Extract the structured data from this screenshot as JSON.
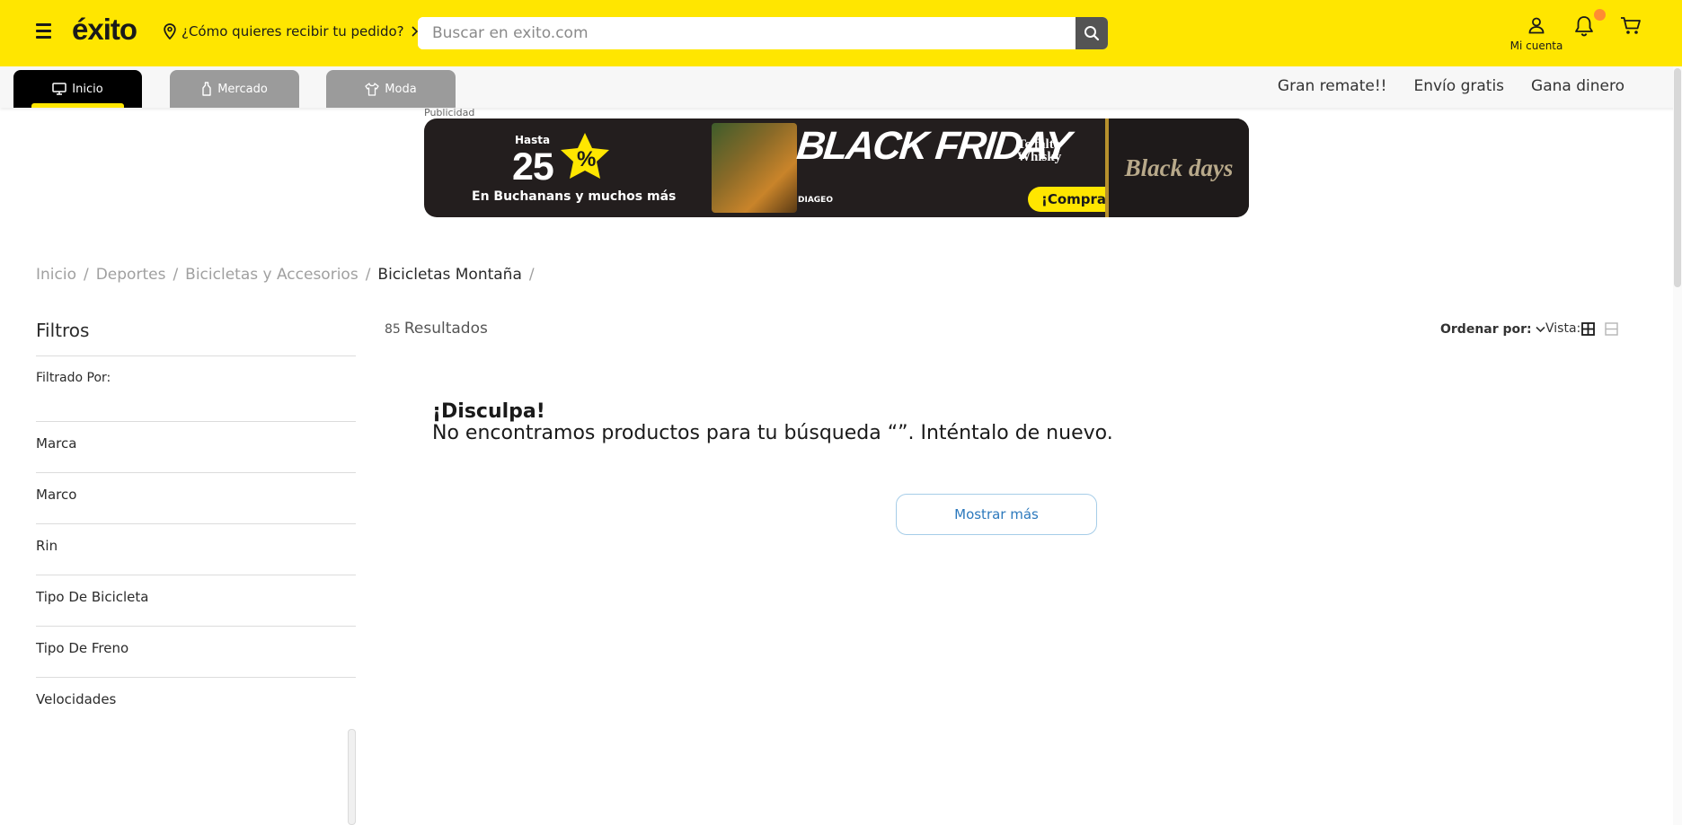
{
  "header": {
    "logo": "éxito",
    "location_prompt": "¿Cómo quieres recibir tu pedido?",
    "search_placeholder": "Buscar en exito.com",
    "account_label": "Mi cuenta"
  },
  "nav": {
    "tabs": [
      {
        "label": "Inicio",
        "icon": "monitor-icon",
        "active": true
      },
      {
        "label": "Mercado",
        "icon": "bottle-icon",
        "active": false
      },
      {
        "label": "Moda",
        "icon": "shirt-icon",
        "active": false
      }
    ],
    "links": [
      "Gran remate!!",
      "Envío gratis",
      "Gana dinero"
    ]
  },
  "ad": {
    "label": "Publicidad",
    "close": "✕",
    "hasta": "Hasta",
    "percent": "25",
    "percent_sign": "%",
    "subtitle": "En Buchanans y muchos más",
    "headline": "BLACK FRIDAY",
    "tagline": "Te falta Whisky",
    "brand": "DIAGEO",
    "cta": "¡Compra ya!",
    "badge": "Black days"
  },
  "breadcrumb": {
    "items": [
      "Inicio",
      "Deportes",
      "Bicicletas y Accesorios",
      "Bicicletas Montaña"
    ],
    "separator": "/"
  },
  "filters": {
    "title": "Filtros",
    "filtered_by": "Filtrado Por:",
    "facets": [
      "Marca",
      "Marco",
      "Rin",
      "Tipo De Bicicleta",
      "Tipo De Freno",
      "Velocidades"
    ]
  },
  "results": {
    "count": "85",
    "label": "Resultados",
    "sort_label": "Ordenar por:",
    "view_label": "Vista:",
    "empty_title": "¡Disculpa!",
    "empty_message": "No encontramos productos para tu búsqueda  “”. Inténtalo de nuevo.",
    "more_button": "Mostrar más"
  },
  "colors": {
    "brand_yellow": "#ffe600",
    "black": "#000000",
    "inactive_tab": "#9b9b9b",
    "link_blue": "#2c79bd",
    "notification": "#ff8c32"
  }
}
